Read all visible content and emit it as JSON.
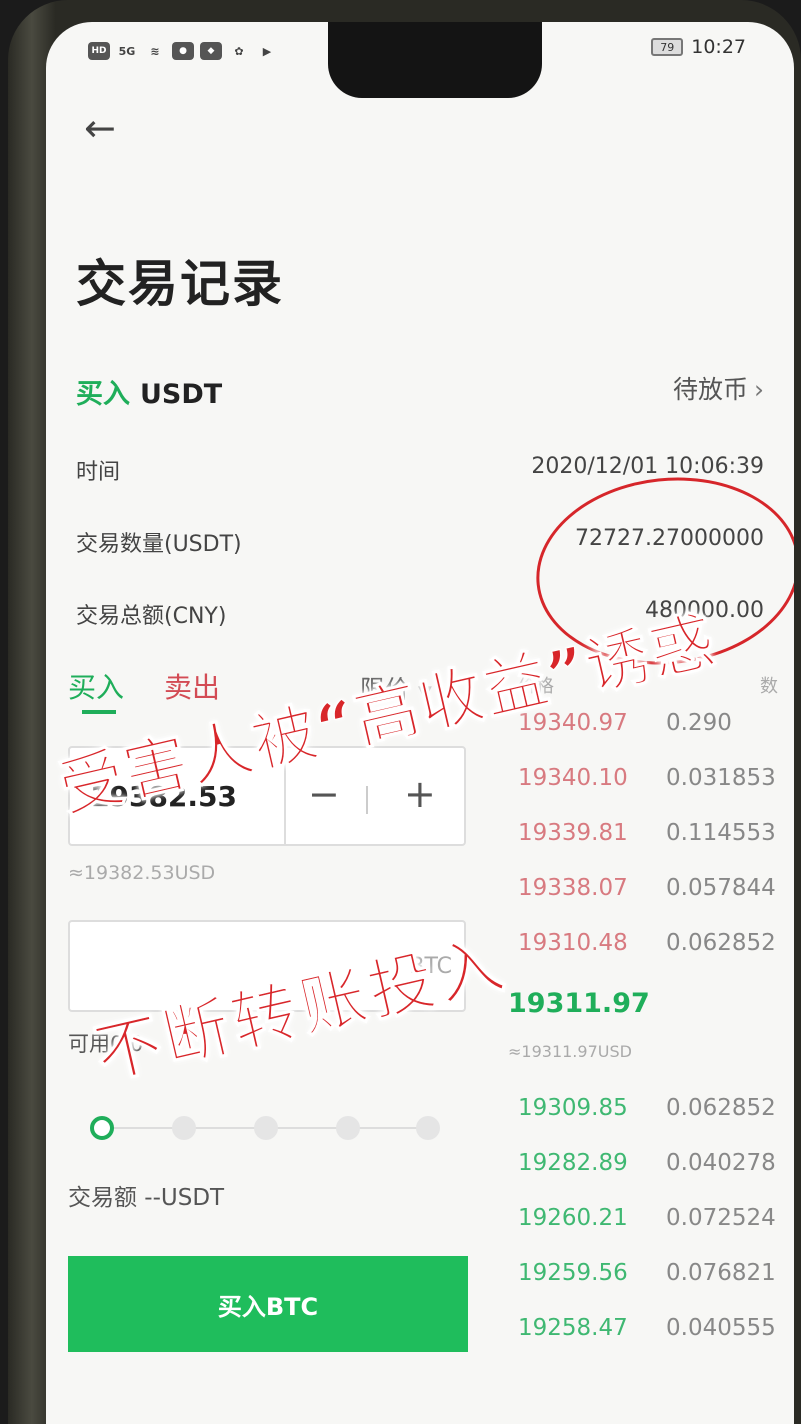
{
  "status_bar": {
    "time": "10:27",
    "battery": "79",
    "hd": "HD",
    "network": "5G"
  },
  "page": {
    "title": "交易记录"
  },
  "order": {
    "side": "买入",
    "asset": "USDT",
    "status": "待放币",
    "rows": [
      {
        "label": "时间",
        "value": "2020/12/01 10:06:39"
      },
      {
        "label": "交易数量(USDT)",
        "value": "72727.27000000"
      },
      {
        "label": "交易总额(CNY)",
        "value": "480000.00"
      }
    ]
  },
  "trade": {
    "tab_buy": "买入",
    "tab_sell": "卖出",
    "order_type": "限价",
    "price": "19382.53",
    "price_approx": "≈19382.53USD",
    "amount_unit": "BTC",
    "available": "可用0.0",
    "trade_total": "交易额 --USDT",
    "buy_button": "买入BTC",
    "slider_value": 0
  },
  "order_book": {
    "col_price": "价格",
    "col_qty": "数",
    "asks": [
      {
        "price": "19340.97",
        "qty": "0.290"
      },
      {
        "price": "19340.10",
        "qty": "0.031853"
      },
      {
        "price": "19339.81",
        "qty": "0.114553"
      },
      {
        "price": "19338.07",
        "qty": "0.057844"
      },
      {
        "price": "19310.48",
        "qty": "0.062852"
      }
    ],
    "last_price": "19311.97",
    "last_price_approx": "≈19311.97USD",
    "bids": [
      {
        "price": "19309.85",
        "qty": "0.062852"
      },
      {
        "price": "19282.89",
        "qty": "0.040278"
      },
      {
        "price": "19260.21",
        "qty": "0.072524"
      },
      {
        "price": "19259.56",
        "qty": "0.076821"
      },
      {
        "price": "19258.47",
        "qty": "0.040555"
      }
    ]
  },
  "overlay": {
    "line1": "受害人被“高收益”诱惑",
    "line2": "不断转账投入"
  },
  "colors": {
    "buy_green": "#1fae5a",
    "sell_red": "#d34b54",
    "annotation_red": "#d8262a"
  }
}
